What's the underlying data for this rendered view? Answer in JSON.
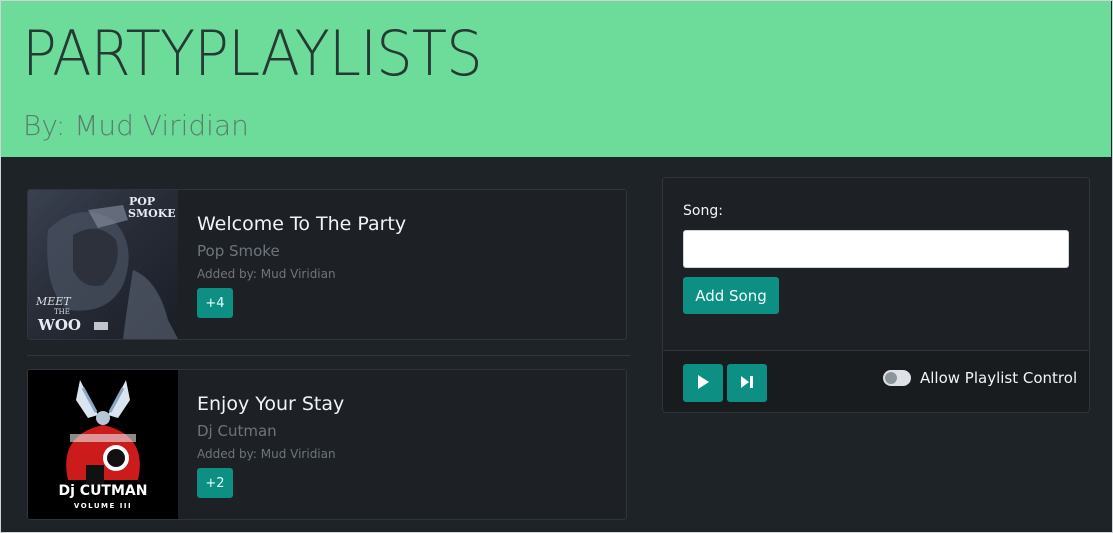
{
  "header": {
    "title": "PARTYPLAYLISTS",
    "subtitle": "By: Mud Viridian"
  },
  "songs": [
    {
      "title": "Welcome To The Party",
      "artist": "Pop Smoke",
      "added_by": "Added by: Mud Viridian",
      "votes": "+4",
      "art_text": {
        "top": "POP SMOKE",
        "bottom_1": "MEET",
        "bottom_2": "THE",
        "bottom_3": "WOO"
      }
    },
    {
      "title": "Enjoy Your Stay",
      "artist": "Dj Cutman",
      "added_by": "Added by: Mud Viridian",
      "votes": "+2",
      "art_text": {
        "top": "Dj CUTMAN",
        "bottom": "VOLUME III"
      }
    }
  ],
  "panel": {
    "song_label": "Song:",
    "song_value": "",
    "add_button": "Add Song",
    "play_icon": "play-icon",
    "skip_icon": "skip-next-icon",
    "allow_control_label": "Allow Playlist Control",
    "allow_control_on": false
  },
  "colors": {
    "header_bg": "#6ddc9b",
    "page_bg": "#1e2327",
    "accent": "#0e8f84"
  }
}
